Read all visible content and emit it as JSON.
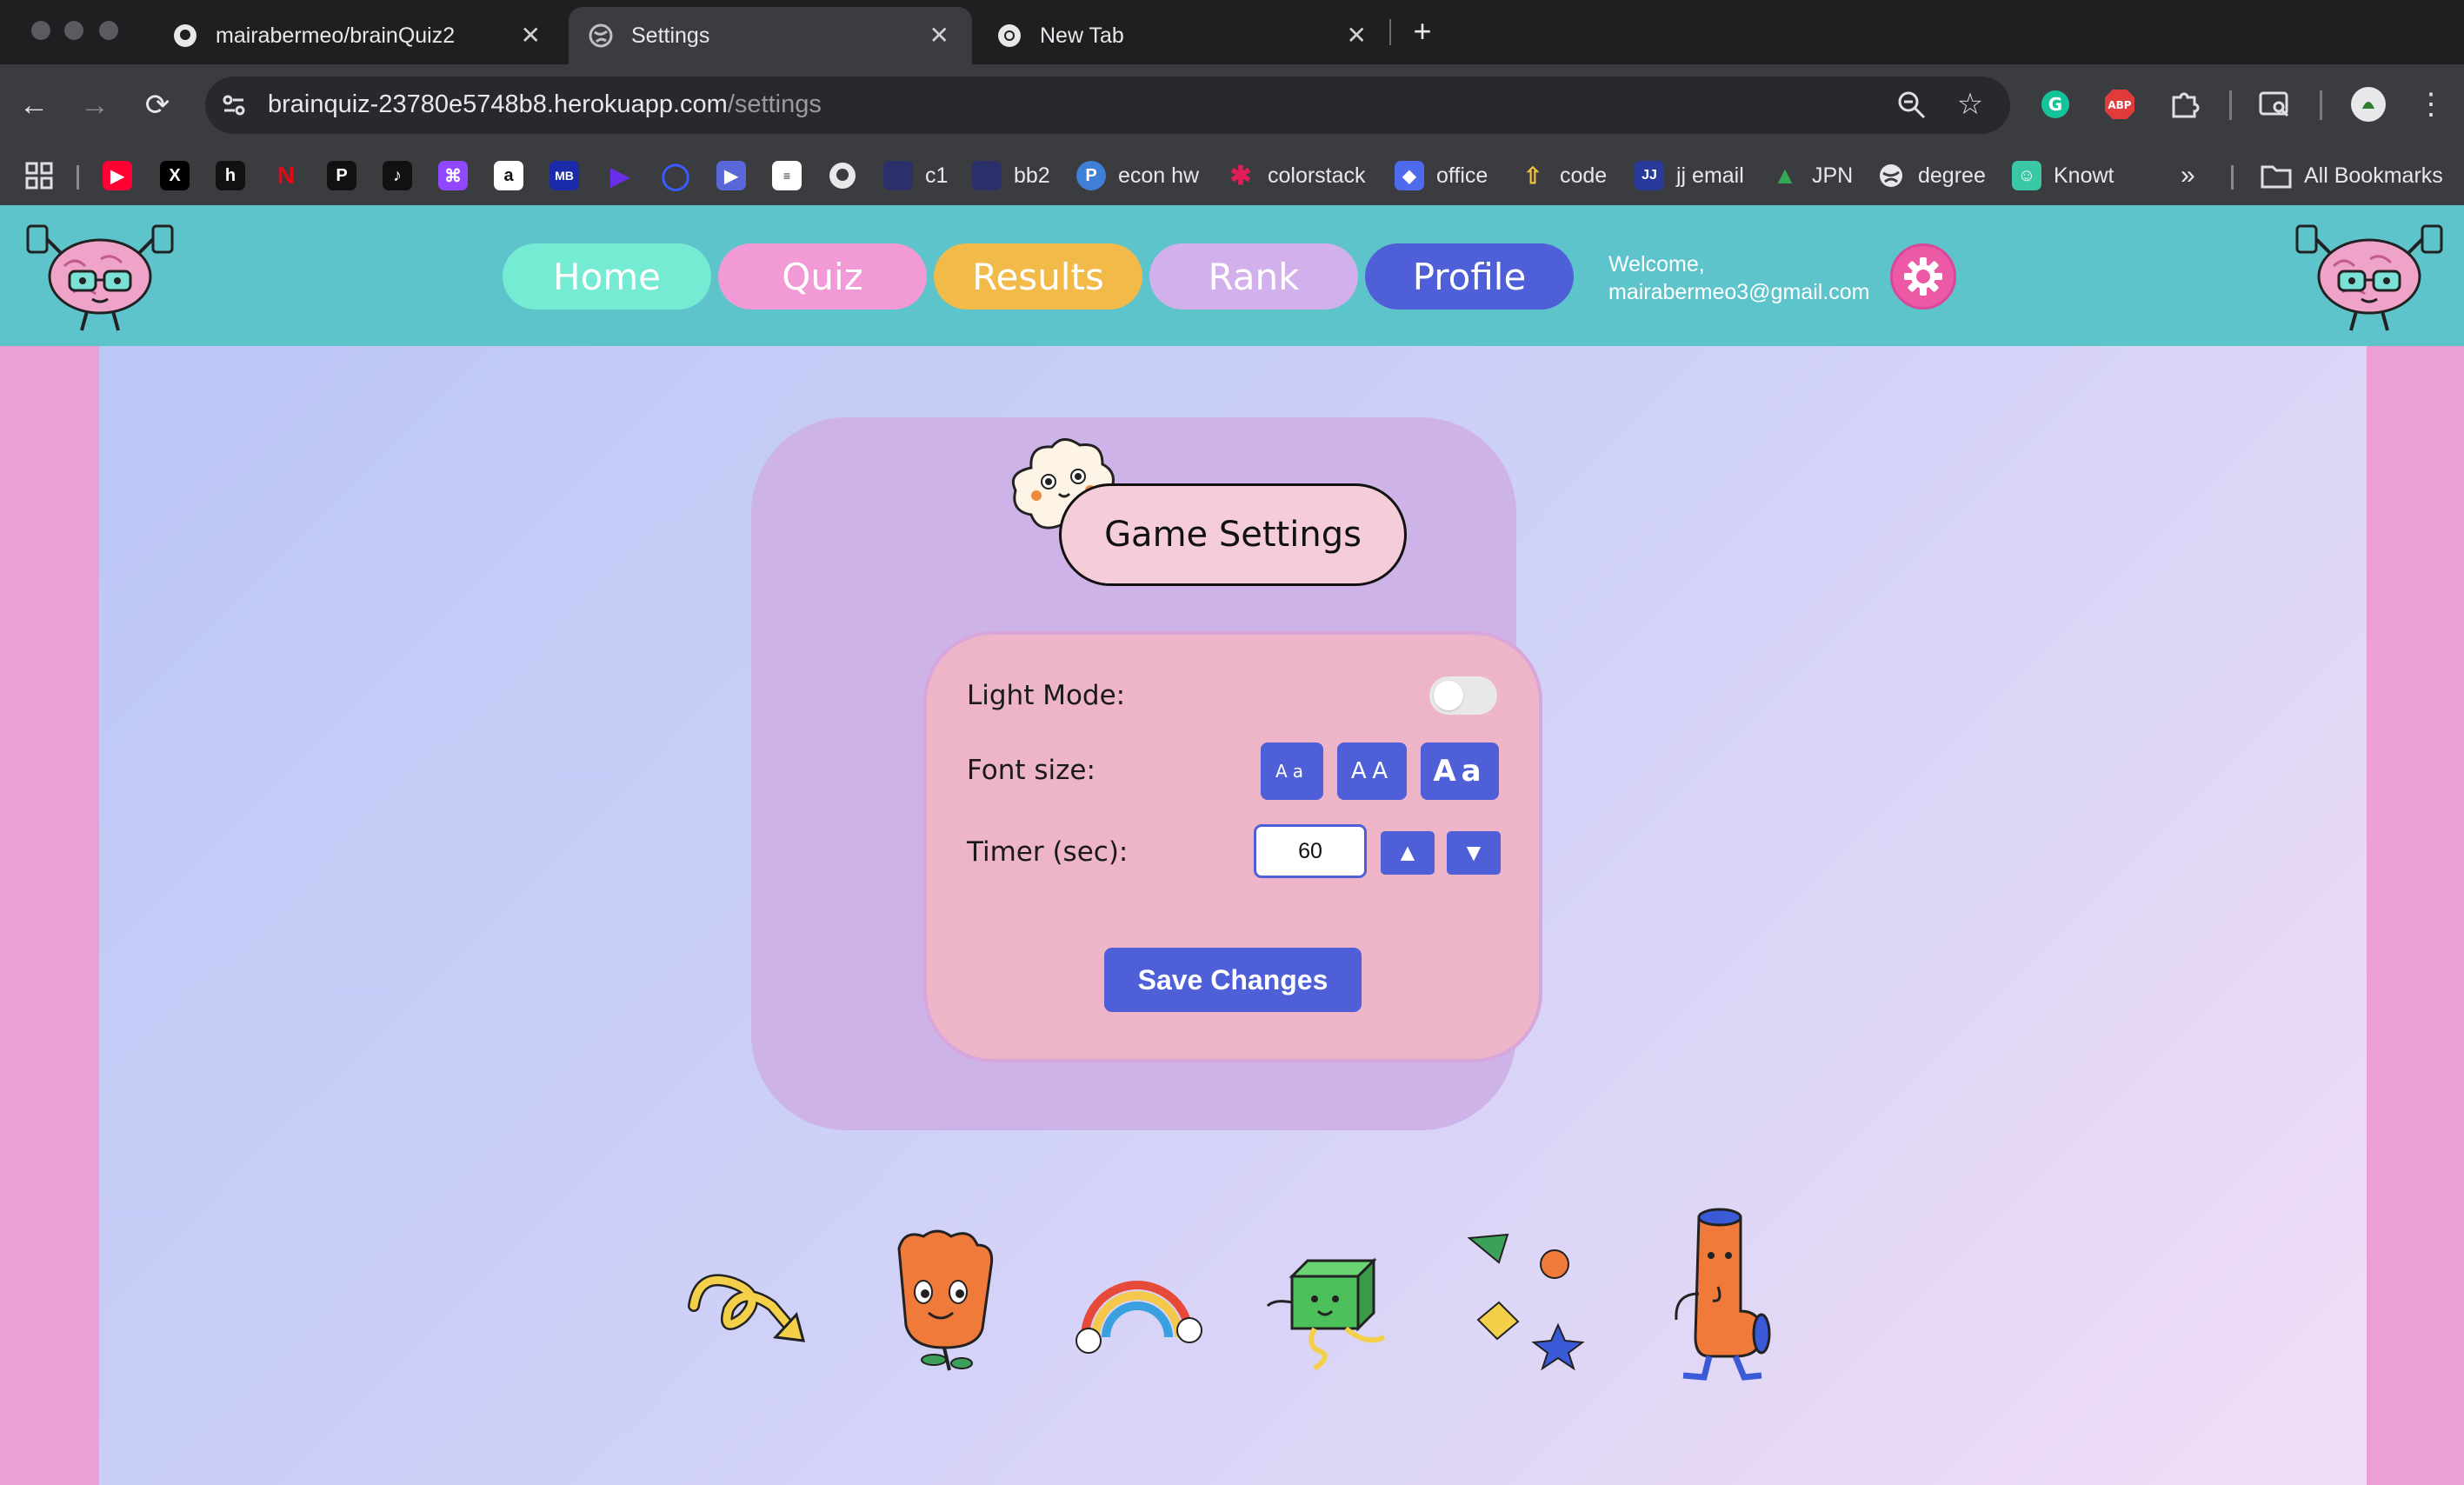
{
  "browser": {
    "tabs": [
      {
        "title": "mairabermeo/brainQuiz2",
        "icon": "github-icon"
      },
      {
        "title": "Settings",
        "icon": "globe-icon"
      },
      {
        "title": "New Tab",
        "icon": "chrome-icon"
      }
    ],
    "url_host": "brainquiz-23780e5748b8.herokuapp.com",
    "url_path": "/settings",
    "bookmarks": [
      {
        "label": "",
        "icon": "youtube-icon",
        "color": "#ff0033"
      },
      {
        "label": "",
        "icon": "x-icon",
        "color": "#000000"
      },
      {
        "label": "",
        "icon": "h-icon",
        "color": "#111111"
      },
      {
        "label": "",
        "icon": "netflix-icon",
        "color": "#e50914"
      },
      {
        "label": "",
        "icon": "p-icon",
        "color": "#111111"
      },
      {
        "label": "",
        "icon": "tiktok-icon",
        "color": "#111111"
      },
      {
        "label": "",
        "icon": "twitch-icon",
        "color": "#9146ff"
      },
      {
        "label": "",
        "icon": "amazon-icon",
        "color": "#ffffff"
      },
      {
        "label": "",
        "icon": "mb-icon",
        "color": "#1a2aa8"
      },
      {
        "label": "",
        "icon": "play-icon",
        "color": "#6a2ee8"
      },
      {
        "label": "",
        "icon": "q-icon",
        "color": "#3a5bff"
      },
      {
        "label": "",
        "icon": "video-icon",
        "color": "#5a67d8"
      },
      {
        "label": "",
        "icon": "doc-icon",
        "color": "#ffffff"
      },
      {
        "label": "",
        "icon": "github-icon",
        "color": "#e8e8ea"
      },
      {
        "label": "c1",
        "icon": "folder-dark-icon",
        "color": "#2b2f6a"
      },
      {
        "label": "bb2",
        "icon": "folder-dark-icon",
        "color": "#2b2f6a"
      },
      {
        "label": "econ hw",
        "icon": "p-circle-icon",
        "color": "#3f7fd8"
      },
      {
        "label": "colorstack",
        "icon": "slack-icon",
        "color": "#e01e5a"
      },
      {
        "label": "office",
        "icon": "office-icon",
        "color": "#4f6bed"
      },
      {
        "label": "code",
        "icon": "rocket-icon",
        "color": "#f0c040"
      },
      {
        "label": "jj email",
        "icon": "jj-icon",
        "color": "#2a3a9a"
      },
      {
        "label": "JPN",
        "icon": "drive-icon",
        "color": "#34a853"
      },
      {
        "label": "degree",
        "icon": "globe-icon",
        "color": "#e8e8ea"
      },
      {
        "label": "Knowt",
        "icon": "knowt-icon",
        "color": "#3ac7a6"
      }
    ],
    "all_bookmarks": "All Bookmarks"
  },
  "app": {
    "nav": [
      {
        "label": "Home",
        "color": "#76ebd4"
      },
      {
        "label": "Quiz",
        "color": "#f29ad6"
      },
      {
        "label": "Results",
        "color": "#f2ba48"
      },
      {
        "label": "Rank",
        "color": "#d2b0ec"
      },
      {
        "label": "Profile",
        "color": "#4e5fd7"
      }
    ],
    "welcome_line1": "Welcome,",
    "welcome_email": "mairabermeo3@gmail.com"
  },
  "settings": {
    "title": "Game Settings",
    "light_mode_label": "Light Mode:",
    "light_mode_on": false,
    "font_size_label": "Font size:",
    "font_options": [
      "Aa",
      "AA",
      "Aa"
    ],
    "timer_label": "Timer (sec):",
    "timer_value": "60",
    "save_label": "Save Changes"
  },
  "colors": {
    "accent": "#4e5fd7",
    "header": "#5ec4cc",
    "side": "#ec9ed7"
  }
}
